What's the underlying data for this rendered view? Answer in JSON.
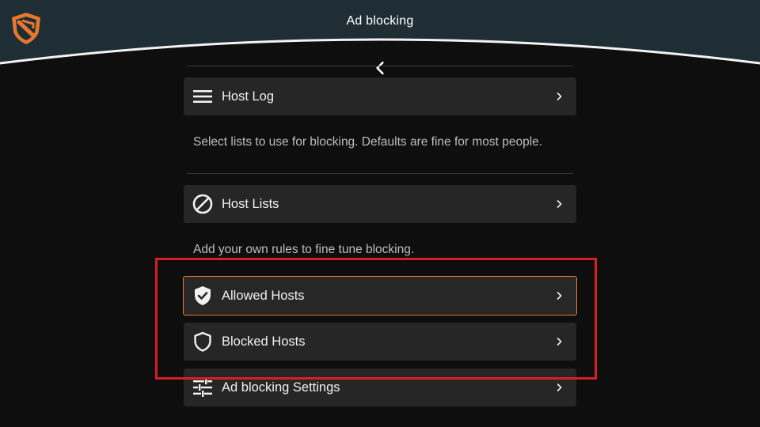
{
  "header": {
    "title": "Ad blocking",
    "logo_icon": "blokada-shield-logo",
    "back_icon": "chevron-left-icon",
    "bg_color": "#1f2e35",
    "accent_color": "#e8772e"
  },
  "main": {
    "items": [
      {
        "label": "Host Log",
        "icon": "menu-lines-icon"
      },
      {
        "label": "Host Lists",
        "icon": "block-circle-icon"
      },
      {
        "label": "Allowed Hosts",
        "icon": "shield-check-icon"
      },
      {
        "label": "Blocked Hosts",
        "icon": "shield-outline-icon"
      },
      {
        "label": "Ad blocking Settings",
        "icon": "sliders-icon"
      }
    ],
    "descriptions": {
      "lists": "Select lists to use for blocking. Defaults are fine for most people.",
      "rules": "Add your own rules to fine tune blocking."
    },
    "focused_item": "Allowed Hosts",
    "highlight_color": "#d51f26"
  }
}
